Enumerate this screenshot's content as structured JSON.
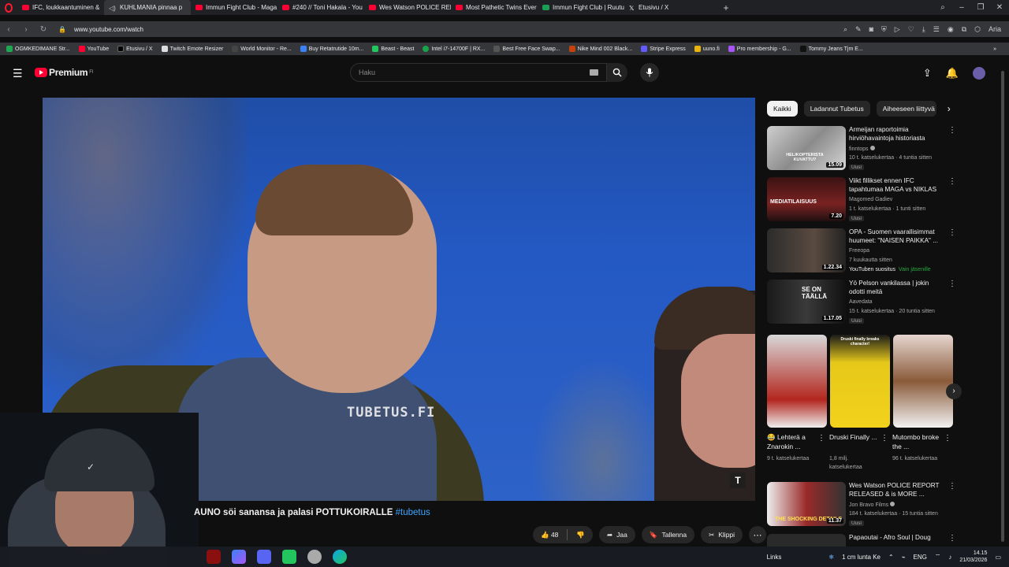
{
  "browser": {
    "tabs": [
      {
        "label": "IFC, loukkaantuminen &"
      },
      {
        "label": "KUHLMANIA pinnaa p",
        "active": true
      },
      {
        "label": "Immun Fight Club - Maga"
      },
      {
        "label": "#240 // Toni Hakala - You"
      },
      {
        "label": "Wes Watson POLICE REPC"
      },
      {
        "label": "Most Pathetic Twins Ever"
      },
      {
        "label": "Immun Fight Club | Ruutu"
      },
      {
        "label": "Etusivu / X"
      }
    ],
    "url": "www.youtube.com/watch",
    "bookmarks": [
      "OGMKEDIMANE Str...",
      "YouTube",
      "Etusivu / X",
      "Twitch Emote Resizer",
      "World Monitor - Re...",
      "Buy Retatrutide 10m...",
      "Beast - Beast",
      "Intel i7-14700F | RX...",
      "Best Free Face Swap...",
      "Nike Mind 002 Black...",
      "Stripe Express",
      "uuno.fi",
      "Pro membership - G...",
      "Tommy Jeans Tjm E..."
    ],
    "ai_label": "Aria"
  },
  "youtube": {
    "logo_text": "Premium",
    "region": "FI",
    "search_placeholder": "Haku",
    "watermark": "TUBETUS.FI",
    "title_main": "AUNO söi sanansa ja palasi POTTUKOIRALLE",
    "title_tag": "#tubetus",
    "likes": "48",
    "share_label": "Jaa",
    "save_label": "Tallenna",
    "clip_label": "Klippi"
  },
  "chips": [
    "Kaikki",
    "Ladannut Tubetus",
    "Aiheeseen liittyvä"
  ],
  "recommendations": [
    {
      "title": "Armeijan raportoimia hirviöhavaintoja historiasta",
      "channel": "finntops",
      "meta": "10 t. katselukertaa · 4 tuntia sitten",
      "badge": "Uusi",
      "duration": "15.09"
    },
    {
      "title": "Viikt fillikset ennen IFC tapahtumaa MAGA vs NIKLAS",
      "channel": "Magomed Gadiev",
      "meta": "1 t. katselukertaa · 1 tunti sitten",
      "badge": "Uusi",
      "duration": "7.20"
    },
    {
      "title": "OPA - Suomen vaarallisimmat huumeet: \"NAISEN PAIKKA\" ...",
      "channel": "Freeopa",
      "meta": "7 kuukautta sitten",
      "extra": "YouTuben suositus",
      "members": "Vain jäsenille",
      "duration": "1.22.34"
    },
    {
      "title": "Yö Pelson vankilassa | jokin odotti meitä",
      "channel": "Aavedata",
      "meta": "15 t. katselukertaa · 20 tuntia sitten",
      "badge": "Uusi",
      "duration": "1.17.05"
    },
    {
      "title": "Wes Watson POLICE REPORT RELEASED & is MORE ...",
      "channel": "Jon Bravo Films",
      "meta": "184 t. katselukertaa · 15 tuntia sitten",
      "badge": "Uusi",
      "duration": "11.37"
    },
    {
      "title": "Papaoutai - Afro Soul | Doug",
      "channel": "",
      "meta": "",
      "duration": ""
    }
  ],
  "shorts": [
    {
      "title": "😂 Lehterä a Znarokin ...",
      "views": "9 t. katselukertaa"
    },
    {
      "title": "Druski Finally ...",
      "views": "1,8 milj. katselukertaa"
    },
    {
      "title": "Mutombo broke the ...",
      "views": "96 t. katselukertaa"
    }
  ],
  "short_banner": "Druski finally breaks character!",
  "thumb_texts": {
    "t1": "HELIKOPTERISTA KUVATTU?",
    "t2": "MEDIATILAISUUS",
    "t3": "SE ON TÄÄLLÄ",
    "t4": "THE SHOCKING DETAILS"
  },
  "taskbar": {
    "links_label": "Links",
    "weather": "1 cm lunta Ke",
    "lang": "ENG",
    "time": "14.15",
    "date": "21/03/2026"
  },
  "colors": {
    "accent": "#ff0033",
    "link": "#3ea6ff",
    "bg": "#0f0f0f",
    "member": "#2ba640"
  }
}
